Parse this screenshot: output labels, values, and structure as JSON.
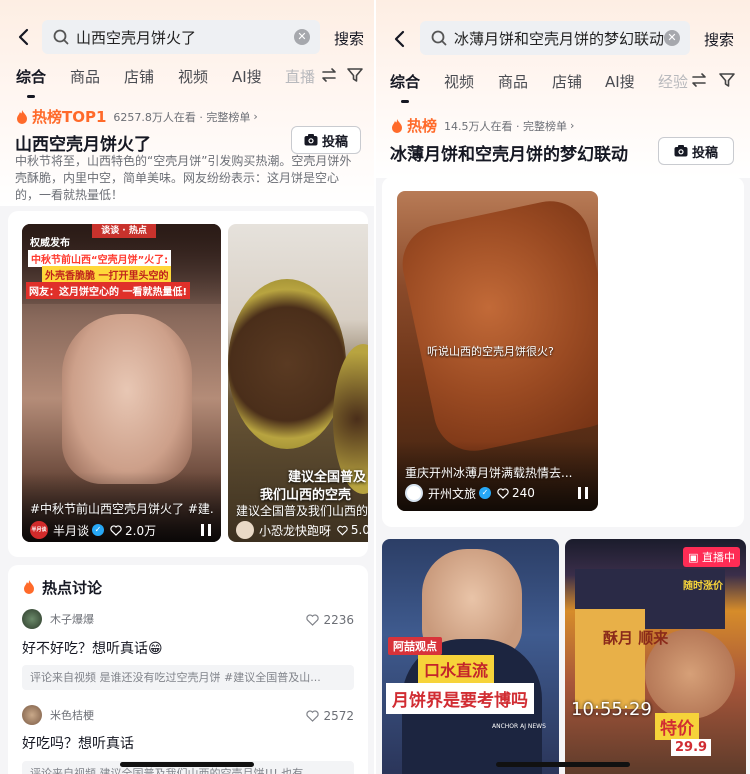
{
  "left": {
    "search_query": "山西空壳月饼火了",
    "search_button": "搜索",
    "tabs": [
      "综合",
      "商品",
      "店铺",
      "视频",
      "AI搜",
      "直播"
    ],
    "hot_label": "热榜TOP1",
    "hot_meta": "6257.8万人在看 · 完整榜单",
    "topic_title": "山西空壳月饼火了",
    "tougao_label": "投稿",
    "description": "中秋节将至，山西特色的“空壳月饼”引发购买热潮。空壳月饼外壳酥脆，内里中空，简单美味。网友纷纷表示：这月饼是空心的，一看就热量低！",
    "video1": {
      "corner_tag": "权威发布",
      "badge": "谈谈 · 热点",
      "line1": "中秋节前山西“空壳月饼”火了:",
      "line2": "外壳香脆脆 一打开里头空的",
      "line3": "网友：这月饼空心的 一看就热量低!",
      "caption": "#中秋节前山西空壳月饼火了 #建...",
      "author": "半月谈",
      "likes": "2.0万",
      "avatar_text": "半月谈"
    },
    "video2": {
      "overlay_line1": "建议全国普及",
      "overlay_line2": "我们山西的空壳",
      "caption": "建议全国普及我们山西的空壳月...",
      "author": "小恐龙快跑呀",
      "likes": "5.0"
    },
    "discussion_title": "热点讨论",
    "comments": [
      {
        "user": "木子爆爆",
        "likes": "2236",
        "text": "好不好吃？想听真话😁",
        "ref": "评论来自视频 是谁还没有吃过空壳月饼 #建议全国普及山..."
      },
      {
        "user": "米色桔梗",
        "likes": "2572",
        "text": "好吃吗？想听真话",
        "ref": "评论来自视频 建议全国普及我们山西的空壳月饼!!! 也有..."
      }
    ]
  },
  "right": {
    "search_query": "冰薄月饼和空壳月饼的梦幻联动",
    "search_button": "搜索",
    "tabs": [
      "综合",
      "视频",
      "商品",
      "店铺",
      "AI搜",
      "经验"
    ],
    "hot_label": "热榜",
    "hot_meta": "14.5万人在看 · 完整榜单",
    "topic_title": "冰薄月饼和空壳月饼的梦幻联动",
    "tougao_label": "投稿",
    "video1": {
      "subtitle": "听说山西的空壳月饼很火?",
      "caption": "重庆开州冰薄月饼满载热情去...",
      "author": "开州文旅",
      "likes": "240"
    },
    "video2": {
      "tag": "阿喆观点",
      "line1": "口水直流",
      "line2": "月饼界是要考博吗",
      "brand": "ANCHOR AJ NEWS"
    },
    "video3": {
      "live_label": "直播中",
      "price_tag": "特价",
      "timer": "10:55:29",
      "promo": "随时涨价",
      "product": "酥月 顺来",
      "price": "29.9"
    }
  },
  "colors": {
    "hot": "#ff6a2a",
    "verify": "#27a8f6",
    "live": "#fe2c55"
  }
}
